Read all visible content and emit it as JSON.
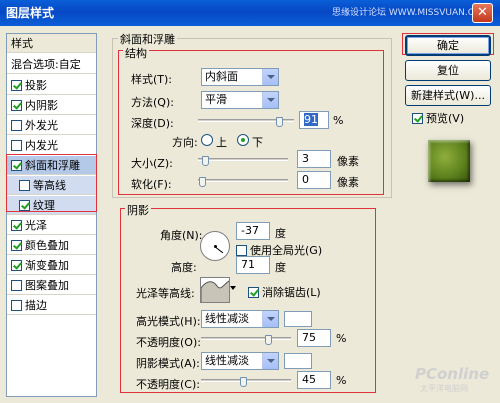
{
  "window": {
    "title": "图层样式",
    "watermark": "思缘设计论坛 WWW.MISSVUAN.COM",
    "close_glyph": "✕"
  },
  "styles_list": {
    "header": "样式",
    "blend_options": "混合选项:自定",
    "items": [
      {
        "label": "投影",
        "checked": true
      },
      {
        "label": "内阴影",
        "checked": true
      },
      {
        "label": "外发光",
        "checked": false
      },
      {
        "label": "内发光",
        "checked": false
      },
      {
        "label": "斜面和浮雕",
        "checked": true
      },
      {
        "label": "等高线",
        "checked": false
      },
      {
        "label": "纹理",
        "checked": true
      },
      {
        "label": "光泽",
        "checked": true
      },
      {
        "label": "颜色叠加",
        "checked": true
      },
      {
        "label": "渐变叠加",
        "checked": true
      },
      {
        "label": "图案叠加",
        "checked": false
      },
      {
        "label": "描边",
        "checked": false
      }
    ]
  },
  "bevel": {
    "section_title": "斜面和浮雕",
    "structure_title": "结构",
    "style_label": "样式(T):",
    "style_value": "内斜面",
    "technique_label": "方法(Q):",
    "technique_value": "平滑",
    "depth_label": "深度(D):",
    "depth_value": "91",
    "depth_unit": "%",
    "direction_label": "方向:",
    "direction_up": "上",
    "direction_down": "下",
    "direction_selected": "下",
    "size_label": "大小(Z):",
    "size_value": "3",
    "size_unit": "像素",
    "soften_label": "软化(F):",
    "soften_value": "0",
    "soften_unit": "像素"
  },
  "shading": {
    "title": "阴影",
    "angle_label": "角度(N):",
    "angle_value": "-37",
    "angle_unit": "度",
    "global_light_label": "使用全局光(G)",
    "global_light_checked": false,
    "altitude_label": "高度:",
    "altitude_value": "71",
    "altitude_unit": "度",
    "gloss_contour_label": "光泽等高线:",
    "antialias_label": "消除锯齿(L)",
    "antialias_checked": true,
    "highlight_mode_label": "高光模式(H):",
    "highlight_mode_value": "线性减淡",
    "highlight_opacity_label": "不透明度(O):",
    "highlight_opacity_value": "75",
    "highlight_opacity_unit": "%",
    "shadow_mode_label": "阴影模式(A):",
    "shadow_mode_value": "线性减淡",
    "shadow_opacity_label": "不透明度(C):",
    "shadow_opacity_value": "45",
    "shadow_opacity_unit": "%"
  },
  "buttons": {
    "ok": "确定",
    "reset": "复位",
    "new_style": "新建样式(W)...",
    "preview_label": "预览(V)",
    "preview_checked": true
  },
  "logo": {
    "text": "PConline",
    "sub": "太平洋电脑网"
  },
  "colors": {
    "title_bar": "#0a5fd8",
    "annotation": "#e0323a",
    "preview_tile": "#6b8e23"
  }
}
